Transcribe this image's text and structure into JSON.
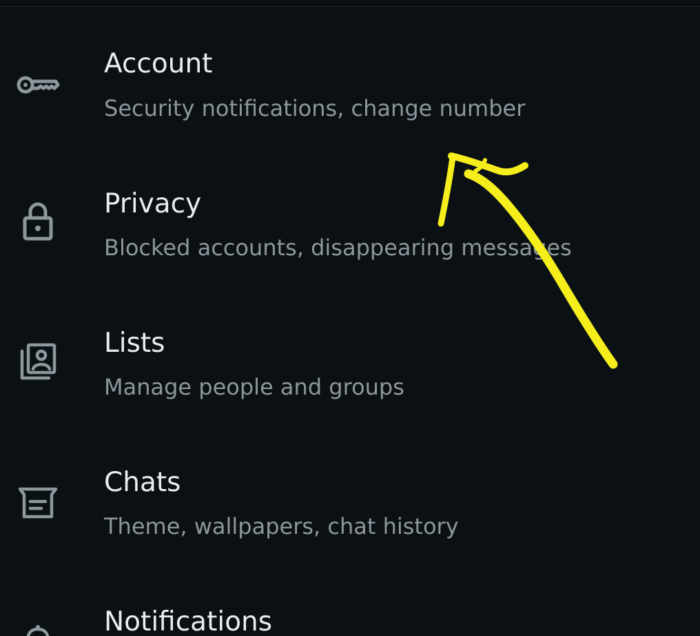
{
  "settings": {
    "items": [
      {
        "id": "account",
        "icon": "key-icon",
        "title": "Account",
        "subtitle": "Security notifications, change number"
      },
      {
        "id": "privacy",
        "icon": "lock-icon",
        "title": "Privacy",
        "subtitle": "Blocked accounts, disappearing messages"
      },
      {
        "id": "lists",
        "icon": "contact-list-icon",
        "title": "Lists",
        "subtitle": "Manage people and groups"
      },
      {
        "id": "chats",
        "icon": "chat-icon",
        "title": "Chats",
        "subtitle": "Theme, wallpapers, chat history"
      },
      {
        "id": "notifications",
        "icon": "bell-icon",
        "title": "Notifications",
        "subtitle": ""
      }
    ]
  },
  "colors": {
    "background": "#0b1014",
    "title": "#e9edef",
    "subtitle": "#8d979c",
    "icon": "#8d979c",
    "annotation": "#f5ee1c"
  }
}
